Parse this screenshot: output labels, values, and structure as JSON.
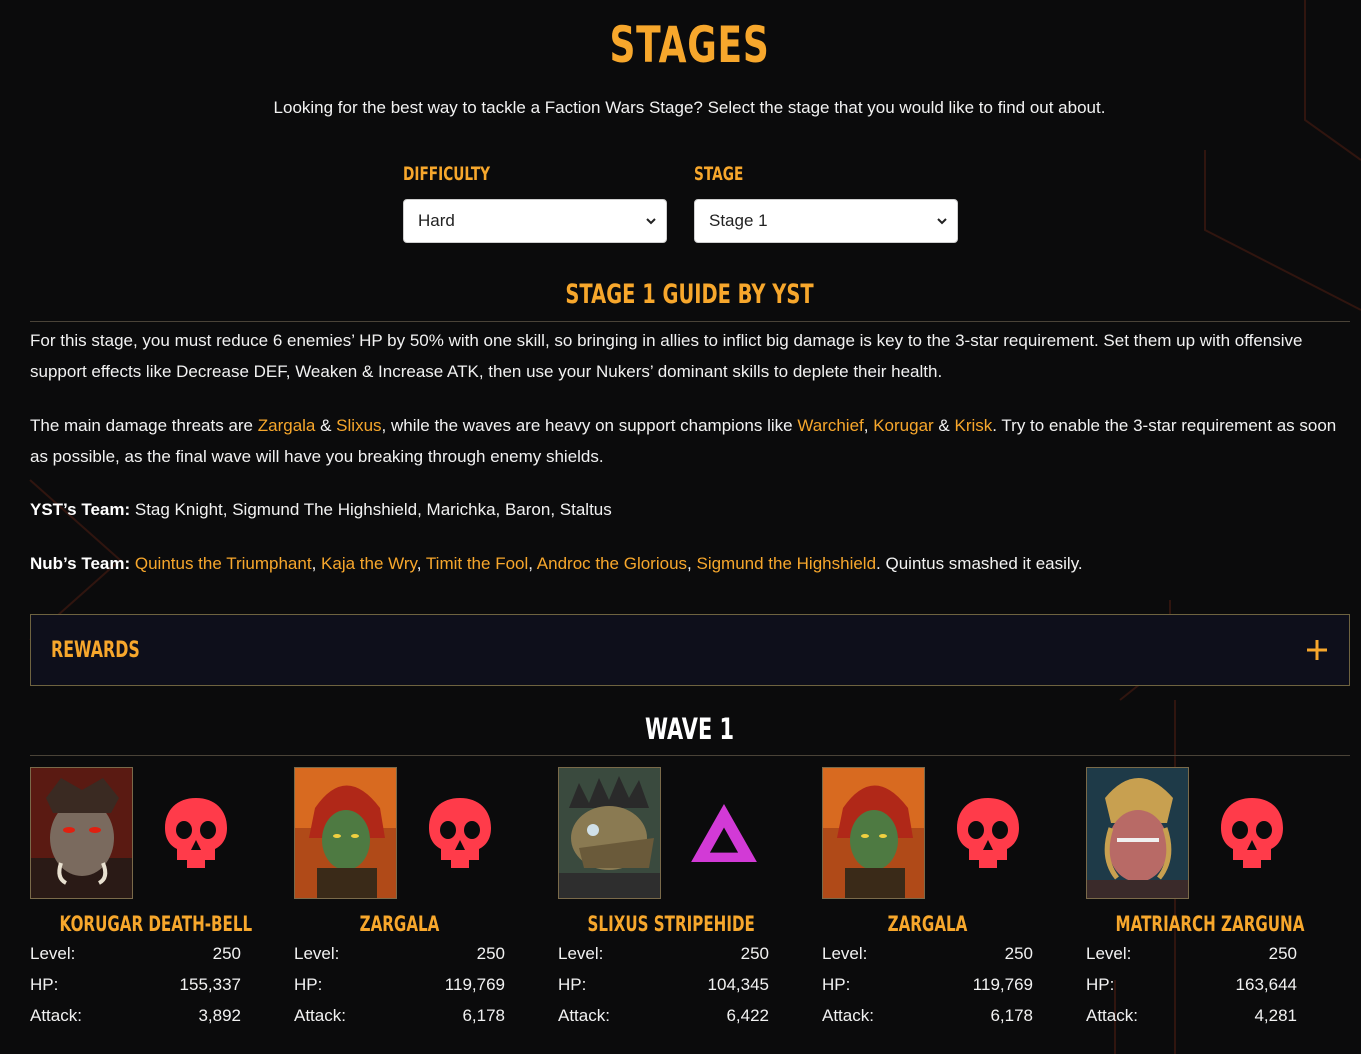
{
  "header": {
    "title": "STAGES",
    "intro": "Looking for the best way to tackle a Faction Wars Stage? Select the stage that you would like to find out about."
  },
  "selectors": {
    "difficulty_label": "DIFFICULTY",
    "difficulty_value": "Hard",
    "stage_label": "STAGE",
    "stage_value": "Stage 1"
  },
  "guide": {
    "title": "STAGE 1 GUIDE BY YST",
    "p1": "For this stage, you must reduce 6 enemies’ HP by 50% with one skill, so bringing in allies to inflict big damage is key to the 3-star requirement. Set them up with offensive support effects like Decrease DEF, Weaken & Increase ATK, then use your Nukers’ dominant skills to deplete their health.",
    "p2_a": "The main damage threats are ",
    "p2_zargala": "Zargala",
    "p2_amp1": " & ",
    "p2_slixus": "Slixus",
    "p2_b": ", while the waves are heavy on support champions like ",
    "p2_warchief": "Warchief",
    "p2_comma": ", ",
    "p2_korugar": "Korugar",
    "p2_amp2": " & ",
    "p2_krisk": "Krisk",
    "p2_c": ". Try to enable the 3-star requirement as soon as possible, as the final wave will have you breaking through enemy shields.",
    "yst_label": "YST’s Team:",
    "yst_team": " Stag Knight, Sigmund The Highshield, Marichka, Baron, Staltus",
    "nub_label": "Nub’s Team:",
    "nub_links": [
      "Quintus the Triumphant",
      "Kaja the Wry",
      "Timit the Fool",
      "Androc the Glorious",
      "Sigmund the Highshield"
    ],
    "nub_sep": ", ",
    "nub_tail": ". Quintus smashed it easily."
  },
  "rewards": {
    "label": "REWARDS"
  },
  "wave": {
    "title": "WAVE 1",
    "stat_labels": {
      "level": "Level:",
      "hp": "HP:",
      "attack": "Attack:"
    },
    "enemies": [
      {
        "name": "KORUGAR DEATH-BELL",
        "affinity": "skull-icon",
        "level": "250",
        "hp": "155,337",
        "attack": "3,892"
      },
      {
        "name": "ZARGALA",
        "affinity": "skull-icon",
        "level": "250",
        "hp": "119,769",
        "attack": "6,178"
      },
      {
        "name": "SLIXUS STRIPEHIDE",
        "affinity": "triangle-icon",
        "level": "250",
        "hp": "104,345",
        "attack": "6,422"
      },
      {
        "name": "ZARGALA",
        "affinity": "skull-icon",
        "level": "250",
        "hp": "119,769",
        "attack": "6,178"
      },
      {
        "name": "MATRIARCH ZARGUNA",
        "affinity": "skull-icon",
        "level": "250",
        "hp": "163,644",
        "attack": "4,281"
      }
    ]
  },
  "colors": {
    "accent": "#f7a72c",
    "skull": "#ff3b4a",
    "triangle": "#d23ad6",
    "background": "#0b0b0c"
  }
}
